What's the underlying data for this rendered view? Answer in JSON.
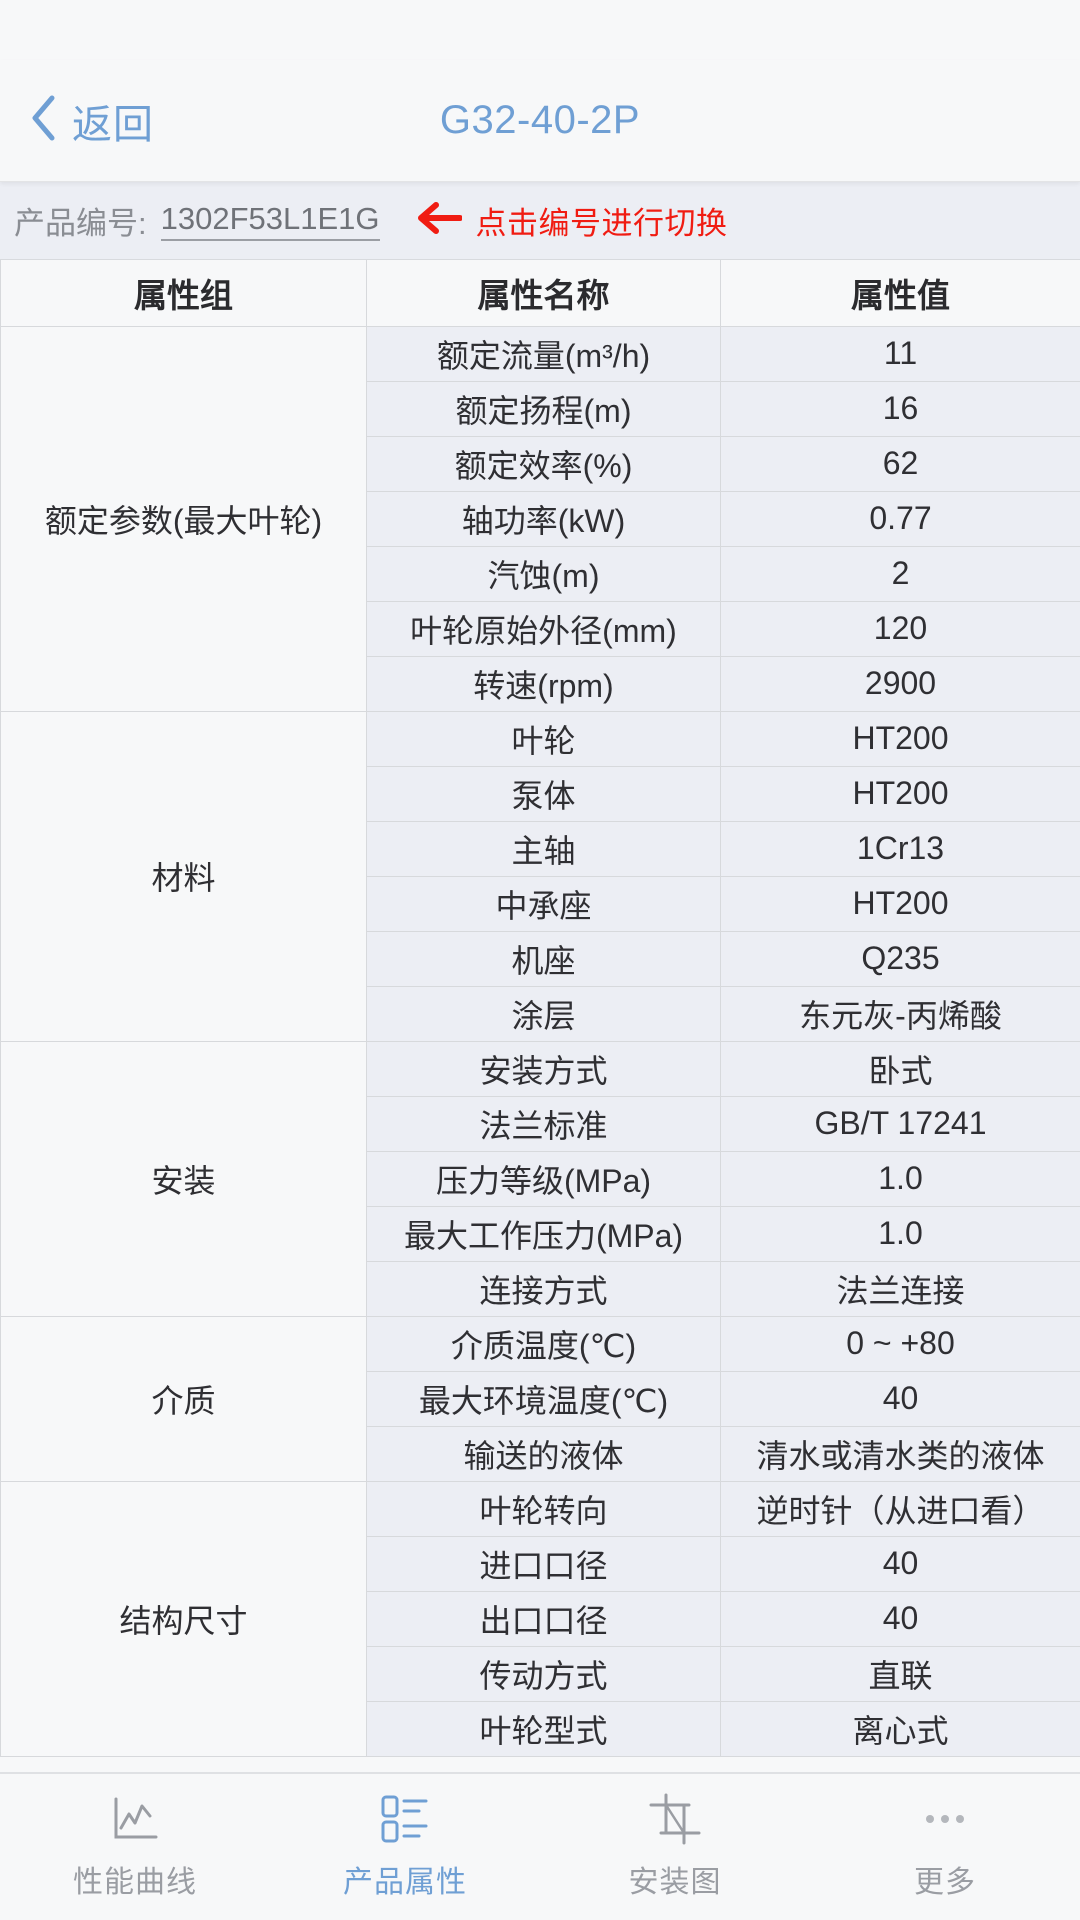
{
  "navbar": {
    "back_label": "返回",
    "back_icon": "chevron-left-icon",
    "title": "G32-40-2P",
    "accent_color": "#6f9fd4"
  },
  "product_bar": {
    "label": "产品编号:",
    "value": "1302F53L1E1G",
    "hint_icon": "arrow-left-icon",
    "hint_text": "点击编号进行切换",
    "hint_color": "#f01c12"
  },
  "table": {
    "headers": [
      "属性组",
      "属性名称",
      "属性值"
    ],
    "groups": [
      {
        "group": "额定参数(最大叶轮)",
        "rows": [
          {
            "name": "额定流量(m³/h)",
            "value": "11"
          },
          {
            "name": "额定扬程(m)",
            "value": "16"
          },
          {
            "name": "额定效率(%)",
            "value": "62"
          },
          {
            "name": "轴功率(kW)",
            "value": "0.77"
          },
          {
            "name": "汽蚀(m)",
            "value": "2"
          },
          {
            "name": "叶轮原始外径(mm)",
            "value": "120"
          },
          {
            "name": "转速(rpm)",
            "value": "2900"
          }
        ]
      },
      {
        "group": "材料",
        "rows": [
          {
            "name": "叶轮",
            "value": "HT200"
          },
          {
            "name": "泵体",
            "value": "HT200"
          },
          {
            "name": "主轴",
            "value": "1Cr13"
          },
          {
            "name": "中承座",
            "value": "HT200"
          },
          {
            "name": "机座",
            "value": "Q235"
          },
          {
            "name": "涂层",
            "value": "东元灰-丙烯酸"
          }
        ]
      },
      {
        "group": "安装",
        "rows": [
          {
            "name": "安装方式",
            "value": "卧式"
          },
          {
            "name": "法兰标准",
            "value": "GB/T 17241"
          },
          {
            "name": "压力等级(MPa)",
            "value": "1.0"
          },
          {
            "name": "最大工作压力(MPa)",
            "value": "1.0"
          },
          {
            "name": "连接方式",
            "value": "法兰连接"
          }
        ]
      },
      {
        "group": "介质",
        "rows": [
          {
            "name": "介质温度(℃)",
            "value": "0 ~ +80"
          },
          {
            "name": "最大环境温度(℃)",
            "value": "40"
          },
          {
            "name": "输送的液体",
            "value": "清水或清水类的液体"
          }
        ]
      },
      {
        "group": "结构尺寸",
        "rows": [
          {
            "name": "叶轮转向",
            "value": "逆时针（从进口看）"
          },
          {
            "name": "进口口径",
            "value": "40"
          },
          {
            "name": "出口口径",
            "value": "40"
          },
          {
            "name": "传动方式",
            "value": "直联"
          },
          {
            "name": "叶轮型式",
            "value": "离心式"
          }
        ]
      }
    ]
  },
  "tabbar": {
    "tabs": [
      {
        "label": "性能曲线",
        "icon": "line-chart-icon",
        "active": false
      },
      {
        "label": "产品属性",
        "icon": "list-attributes-icon",
        "active": true
      },
      {
        "label": "安装图",
        "icon": "crop-drawing-icon",
        "active": false
      },
      {
        "label": "更多",
        "icon": "ellipsis-icon",
        "active": false
      }
    ],
    "active_color": "#6f9fd4",
    "inactive_color": "#9a9da3"
  }
}
